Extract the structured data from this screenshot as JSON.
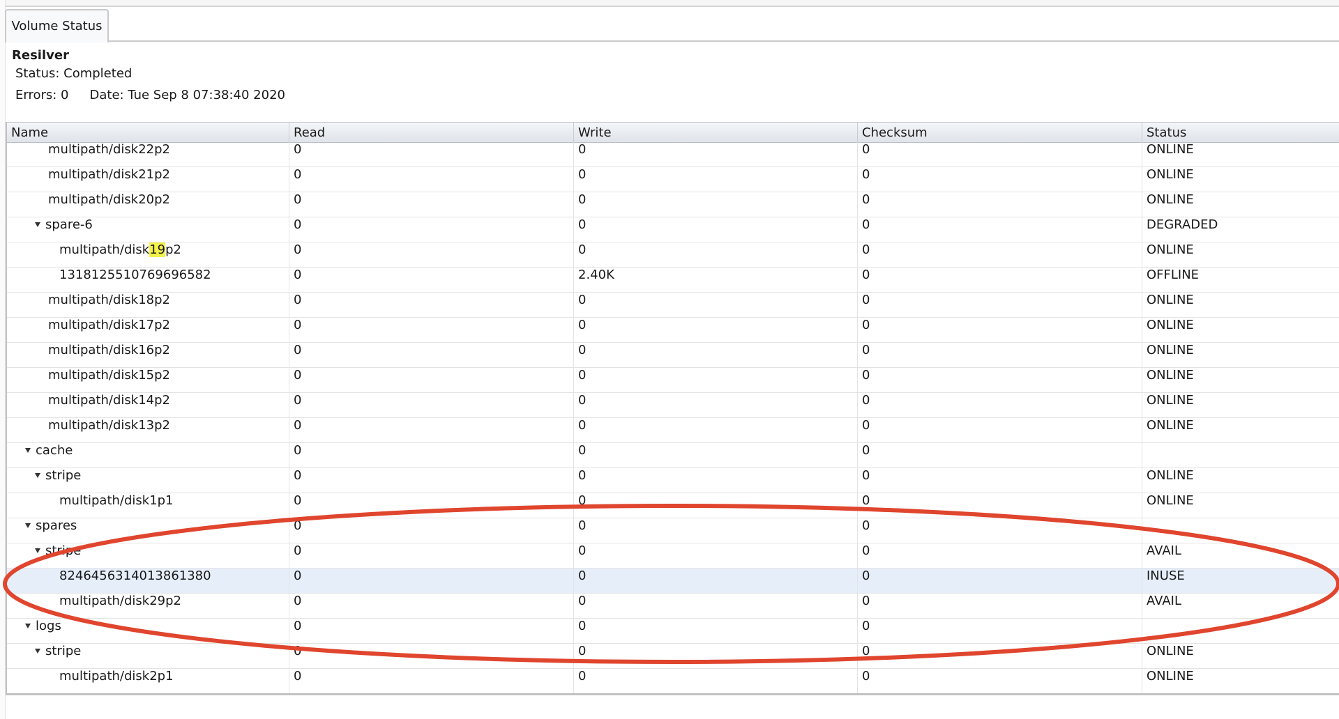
{
  "tab": {
    "label": "Volume Status"
  },
  "resilver": {
    "title": "Resilver",
    "status": "Status: Completed",
    "errors": "Errors: 0",
    "date": "Date: Tue Sep 8 07:38:40 2020"
  },
  "table": {
    "columns": [
      "Name",
      "Read",
      "Write",
      "Checksum",
      "Status"
    ],
    "rows": [
      {
        "name": "multipath/disk22p2",
        "indent": 2,
        "expander": false,
        "read": "0",
        "write": "0",
        "checksum": "0",
        "status": "ONLINE"
      },
      {
        "name": "multipath/disk21p2",
        "indent": 2,
        "expander": false,
        "read": "0",
        "write": "0",
        "checksum": "0",
        "status": "ONLINE"
      },
      {
        "name": "multipath/disk20p2",
        "indent": 2,
        "expander": false,
        "read": "0",
        "write": "0",
        "checksum": "0",
        "status": "ONLINE"
      },
      {
        "name": "spare-6",
        "indent": 2,
        "expander": true,
        "read": "0",
        "write": "0",
        "checksum": "0",
        "status": "DEGRADED"
      },
      {
        "name_prefix": "multipath/disk",
        "name_highlight": "19",
        "name_suffix": "p2",
        "indent": 3,
        "expander": false,
        "read": "0",
        "write": "0",
        "checksum": "0",
        "status": "ONLINE"
      },
      {
        "name": "1318125510769696582",
        "indent": 3,
        "expander": false,
        "read": "0",
        "write": "2.40K",
        "checksum": "0",
        "status": "OFFLINE"
      },
      {
        "name": "multipath/disk18p2",
        "indent": 2,
        "expander": false,
        "read": "0",
        "write": "0",
        "checksum": "0",
        "status": "ONLINE"
      },
      {
        "name": "multipath/disk17p2",
        "indent": 2,
        "expander": false,
        "read": "0",
        "write": "0",
        "checksum": "0",
        "status": "ONLINE"
      },
      {
        "name": "multipath/disk16p2",
        "indent": 2,
        "expander": false,
        "read": "0",
        "write": "0",
        "checksum": "0",
        "status": "ONLINE"
      },
      {
        "name": "multipath/disk15p2",
        "indent": 2,
        "expander": false,
        "read": "0",
        "write": "0",
        "checksum": "0",
        "status": "ONLINE"
      },
      {
        "name": "multipath/disk14p2",
        "indent": 2,
        "expander": false,
        "read": "0",
        "write": "0",
        "checksum": "0",
        "status": "ONLINE"
      },
      {
        "name": "multipath/disk13p2",
        "indent": 2,
        "expander": false,
        "read": "0",
        "write": "0",
        "checksum": "0",
        "status": "ONLINE"
      },
      {
        "name": "cache",
        "indent": 1,
        "expander": true,
        "read": "0",
        "write": "0",
        "checksum": "0",
        "status": ""
      },
      {
        "name": "stripe",
        "indent": 2,
        "expander": true,
        "read": "0",
        "write": "0",
        "checksum": "0",
        "status": "ONLINE"
      },
      {
        "name": "multipath/disk1p1",
        "indent": 3,
        "expander": false,
        "read": "0",
        "write": "0",
        "checksum": "0",
        "status": "ONLINE"
      },
      {
        "name": "spares",
        "indent": 1,
        "expander": true,
        "read": "0",
        "write": "0",
        "checksum": "0",
        "status": ""
      },
      {
        "name": "stripe",
        "indent": 2,
        "expander": true,
        "read": "0",
        "write": "0",
        "checksum": "0",
        "status": "AVAIL"
      },
      {
        "name": "8246456314013861380",
        "indent": 3,
        "expander": false,
        "read": "0",
        "write": "0",
        "checksum": "0",
        "status": "INUSE",
        "selected": true
      },
      {
        "name": "multipath/disk29p2",
        "indent": 3,
        "expander": false,
        "read": "0",
        "write": "0",
        "checksum": "0",
        "status": "AVAIL"
      },
      {
        "name": "logs",
        "indent": 1,
        "expander": true,
        "read": "0",
        "write": "0",
        "checksum": "0",
        "status": ""
      },
      {
        "name": "stripe",
        "indent": 2,
        "expander": true,
        "read": "0",
        "write": "0",
        "checksum": "0",
        "status": "ONLINE"
      },
      {
        "name": "multipath/disk2p1",
        "indent": 3,
        "expander": false,
        "read": "0",
        "write": "0",
        "checksum": "0",
        "status": "ONLINE"
      }
    ]
  },
  "colors": {
    "annotation_ellipse": "#e0452e",
    "selected_row": "#e6eefa",
    "highlight": "#f3f24a"
  }
}
